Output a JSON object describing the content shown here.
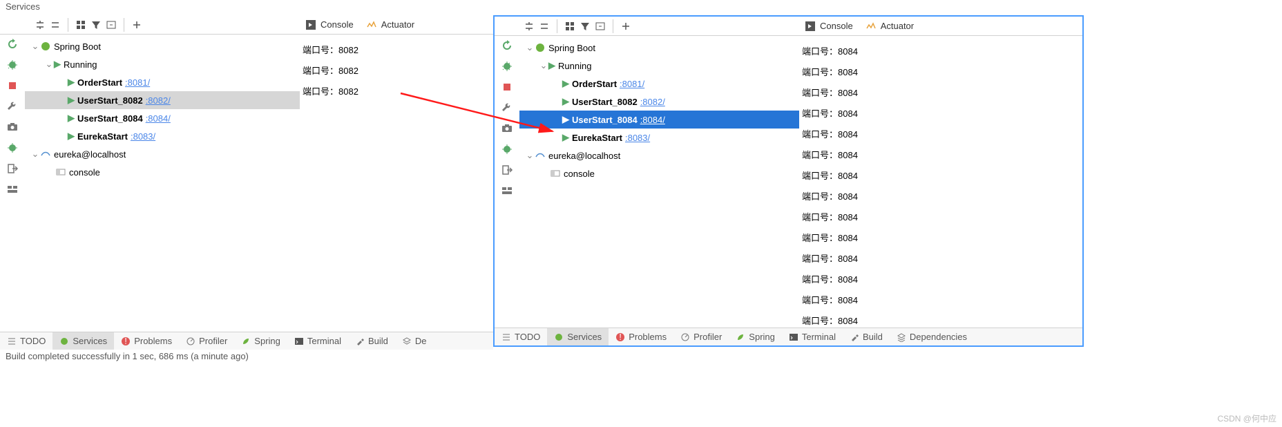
{
  "header": {
    "title": "Services"
  },
  "tree": {
    "root": "Spring Boot",
    "running": "Running",
    "items": [
      {
        "name": "OrderStart",
        "port": ":8081/"
      },
      {
        "name": "UserStart_8082",
        "port": ":8082/"
      },
      {
        "name": "UserStart_8084",
        "port": ":8084/"
      },
      {
        "name": "EurekaStart",
        "port": ":8083/"
      }
    ],
    "eureka": "eureka@localhost",
    "console": "console"
  },
  "consoleTabs": {
    "console": "Console",
    "actuator": "Actuator"
  },
  "leftConsole": {
    "lines": [
      "端口号：8082",
      "端口号：8082",
      "端口号：8082"
    ]
  },
  "rightConsole": {
    "lines": [
      "端口号：8084",
      "端口号：8084",
      "端口号：8084",
      "端口号：8084",
      "端口号：8084",
      "端口号：8084",
      "端口号：8084",
      "端口号：8084",
      "端口号：8084",
      "端口号：8084",
      "端口号：8084",
      "端口号：8084",
      "端口号：8084",
      "端口号：8084"
    ]
  },
  "bottomTabs": {
    "todo": "TODO",
    "services": "Services",
    "problems": "Problems",
    "profiler": "Profiler",
    "spring": "Spring",
    "terminal": "Terminal",
    "build": "Build",
    "deps_short": "De",
    "deps": "Dependencies"
  },
  "status": "Build completed successfully in 1 sec, 686 ms (a minute ago)",
  "watermark": "CSDN @何中应"
}
